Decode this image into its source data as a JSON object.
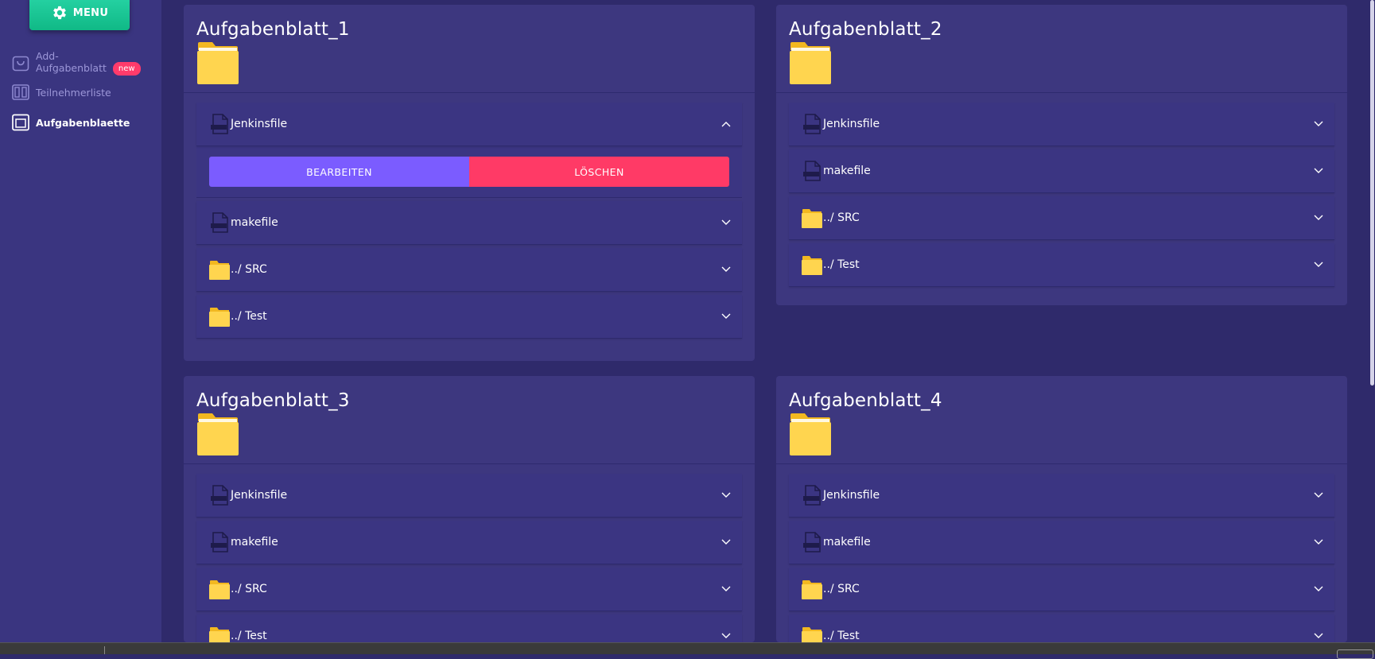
{
  "sidebar": {
    "menu_label": "MENU",
    "items": [
      {
        "label": "Add-",
        "label2": "Aufgabenblatt",
        "badge": "new",
        "icon": "shopping-bag-icon"
      },
      {
        "label": "Teilnehmerliste",
        "icon": "columns-icon"
      },
      {
        "label": "Aufgabenblaette",
        "icon": "window-icon",
        "active": true
      }
    ]
  },
  "cards": [
    {
      "title": "Aufgabenblatt_1",
      "rows": [
        {
          "label": "Jenkinsfile",
          "type": "file",
          "expanded": true
        },
        {
          "label": "makefile",
          "type": "file"
        },
        {
          "label": "../ SRC",
          "type": "folder"
        },
        {
          "label": "../ Test",
          "type": "folder"
        }
      ],
      "actions": {
        "edit": "BEARBEITEN",
        "delete": "LÖSCHEN"
      }
    },
    {
      "title": "Aufgabenblatt_2",
      "rows": [
        {
          "label": "Jenkinsfile",
          "type": "file"
        },
        {
          "label": "makefile",
          "type": "file"
        },
        {
          "label": "../ SRC",
          "type": "folder"
        },
        {
          "label": "../ Test",
          "type": "folder"
        }
      ]
    },
    {
      "title": "Aufgabenblatt_3",
      "rows": [
        {
          "label": "Jenkinsfile",
          "type": "file"
        },
        {
          "label": "makefile",
          "type": "file"
        },
        {
          "label": "../ SRC",
          "type": "folder"
        },
        {
          "label": "../ Test",
          "type": "folder"
        }
      ]
    },
    {
      "title": "Aufgabenblatt_4",
      "rows": [
        {
          "label": "Jenkinsfile",
          "type": "file"
        },
        {
          "label": "makefile",
          "type": "file"
        },
        {
          "label": "../ SRC",
          "type": "folder"
        },
        {
          "label": "../ Test",
          "type": "folder"
        }
      ]
    }
  ],
  "colors": {
    "background": "#2f2a6b",
    "card": "#3d377f",
    "menu_button": "#17c896",
    "edit_button": "#7b5cff",
    "delete_button": "#ff3a66",
    "badge": "#ff3b6b",
    "folder": "#ffd54f"
  }
}
